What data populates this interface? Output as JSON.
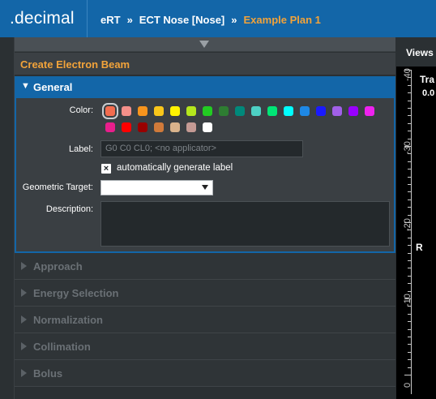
{
  "header": {
    "brand": ".decimal",
    "breadcrumb": [
      {
        "label": "eRT",
        "current": false
      },
      {
        "label": "ECT Nose [Nose]",
        "current": false
      },
      {
        "label": "Example Plan 1",
        "current": true
      }
    ],
    "separator": "»"
  },
  "panel": {
    "title": "Create Electron Beam",
    "general": {
      "title": "General",
      "color_label": "Color:",
      "swatch_colors": [
        "#f26c4f",
        "#f4908a",
        "#f7941d",
        "#f9c61a",
        "#fff200",
        "#b5e61d",
        "#22cc22",
        "#2e7d32",
        "#00897b",
        "#4dd0c4",
        "#00e676",
        "#00ffff",
        "#1e88e5",
        "#1a1aff",
        "#a160e8",
        "#9900ff",
        "#ee22ee",
        "#e91e8c",
        "#ff0000",
        "#990000",
        "#d07a3a",
        "#d9b38c",
        "#c49a94",
        "#ffffff"
      ],
      "selected_swatch": 0,
      "label_label": "Label:",
      "label_placeholder": "G0 C0 CL0;  <no applicator>",
      "auto_label_checked": true,
      "auto_label_text": "automatically generate label",
      "geo_target_label": "Geometric Target:",
      "geo_target_value": "",
      "description_label": "Description:",
      "description_value": ""
    },
    "sections": [
      "Approach",
      "Energy Selection",
      "Normalization",
      "Collimation",
      "Bolus"
    ]
  },
  "views": {
    "tab_label": "Views",
    "overlay_title": "Tra",
    "overlay_value": "0.0",
    "orientation_label": "R",
    "ruler_labels": [
      "-40",
      "-30",
      "-20",
      "-10",
      "0"
    ]
  },
  "colors": {
    "header_bg": "#1366a8",
    "accent": "#f2a33a",
    "panel_bg": "#2b3033"
  }
}
